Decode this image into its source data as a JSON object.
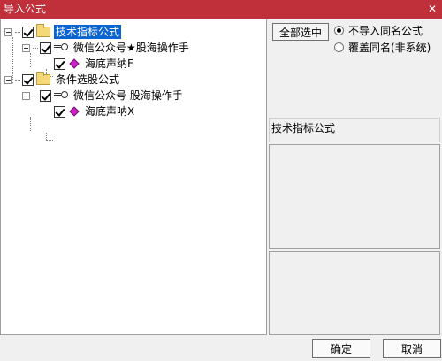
{
  "window": {
    "title": "导入公式",
    "close_glyph": "✕"
  },
  "tree": {
    "nodes": [
      {
        "label": "技术指标公式",
        "icon": "folder-icon",
        "selected": true,
        "checked": true
      },
      {
        "label": "微信公众号★股海操作手",
        "icon": "key-icon",
        "checked": true
      },
      {
        "label": "海底声纳F",
        "icon": "diamond-icon",
        "checked": true
      },
      {
        "label": "条件选股公式",
        "icon": "folder-icon",
        "checked": true
      },
      {
        "label": "微信公众号 股海操作手",
        "icon": "key-icon",
        "checked": true
      },
      {
        "label": "海底声呐X",
        "icon": "diamond-icon",
        "checked": true
      }
    ]
  },
  "options": {
    "select_all_label": "全部选中",
    "radio_skip_label": "不导入同名公式",
    "radio_overwrite_label": "覆盖同名(非系统)",
    "selected_radio": "skip"
  },
  "info": {
    "category_label": "技术指标公式"
  },
  "footer": {
    "ok_label": "确定",
    "cancel_label": "取消"
  },
  "colors": {
    "titlebar": "#c0303a",
    "selection": "#0a64d2",
    "diamond": "#d020c8"
  }
}
